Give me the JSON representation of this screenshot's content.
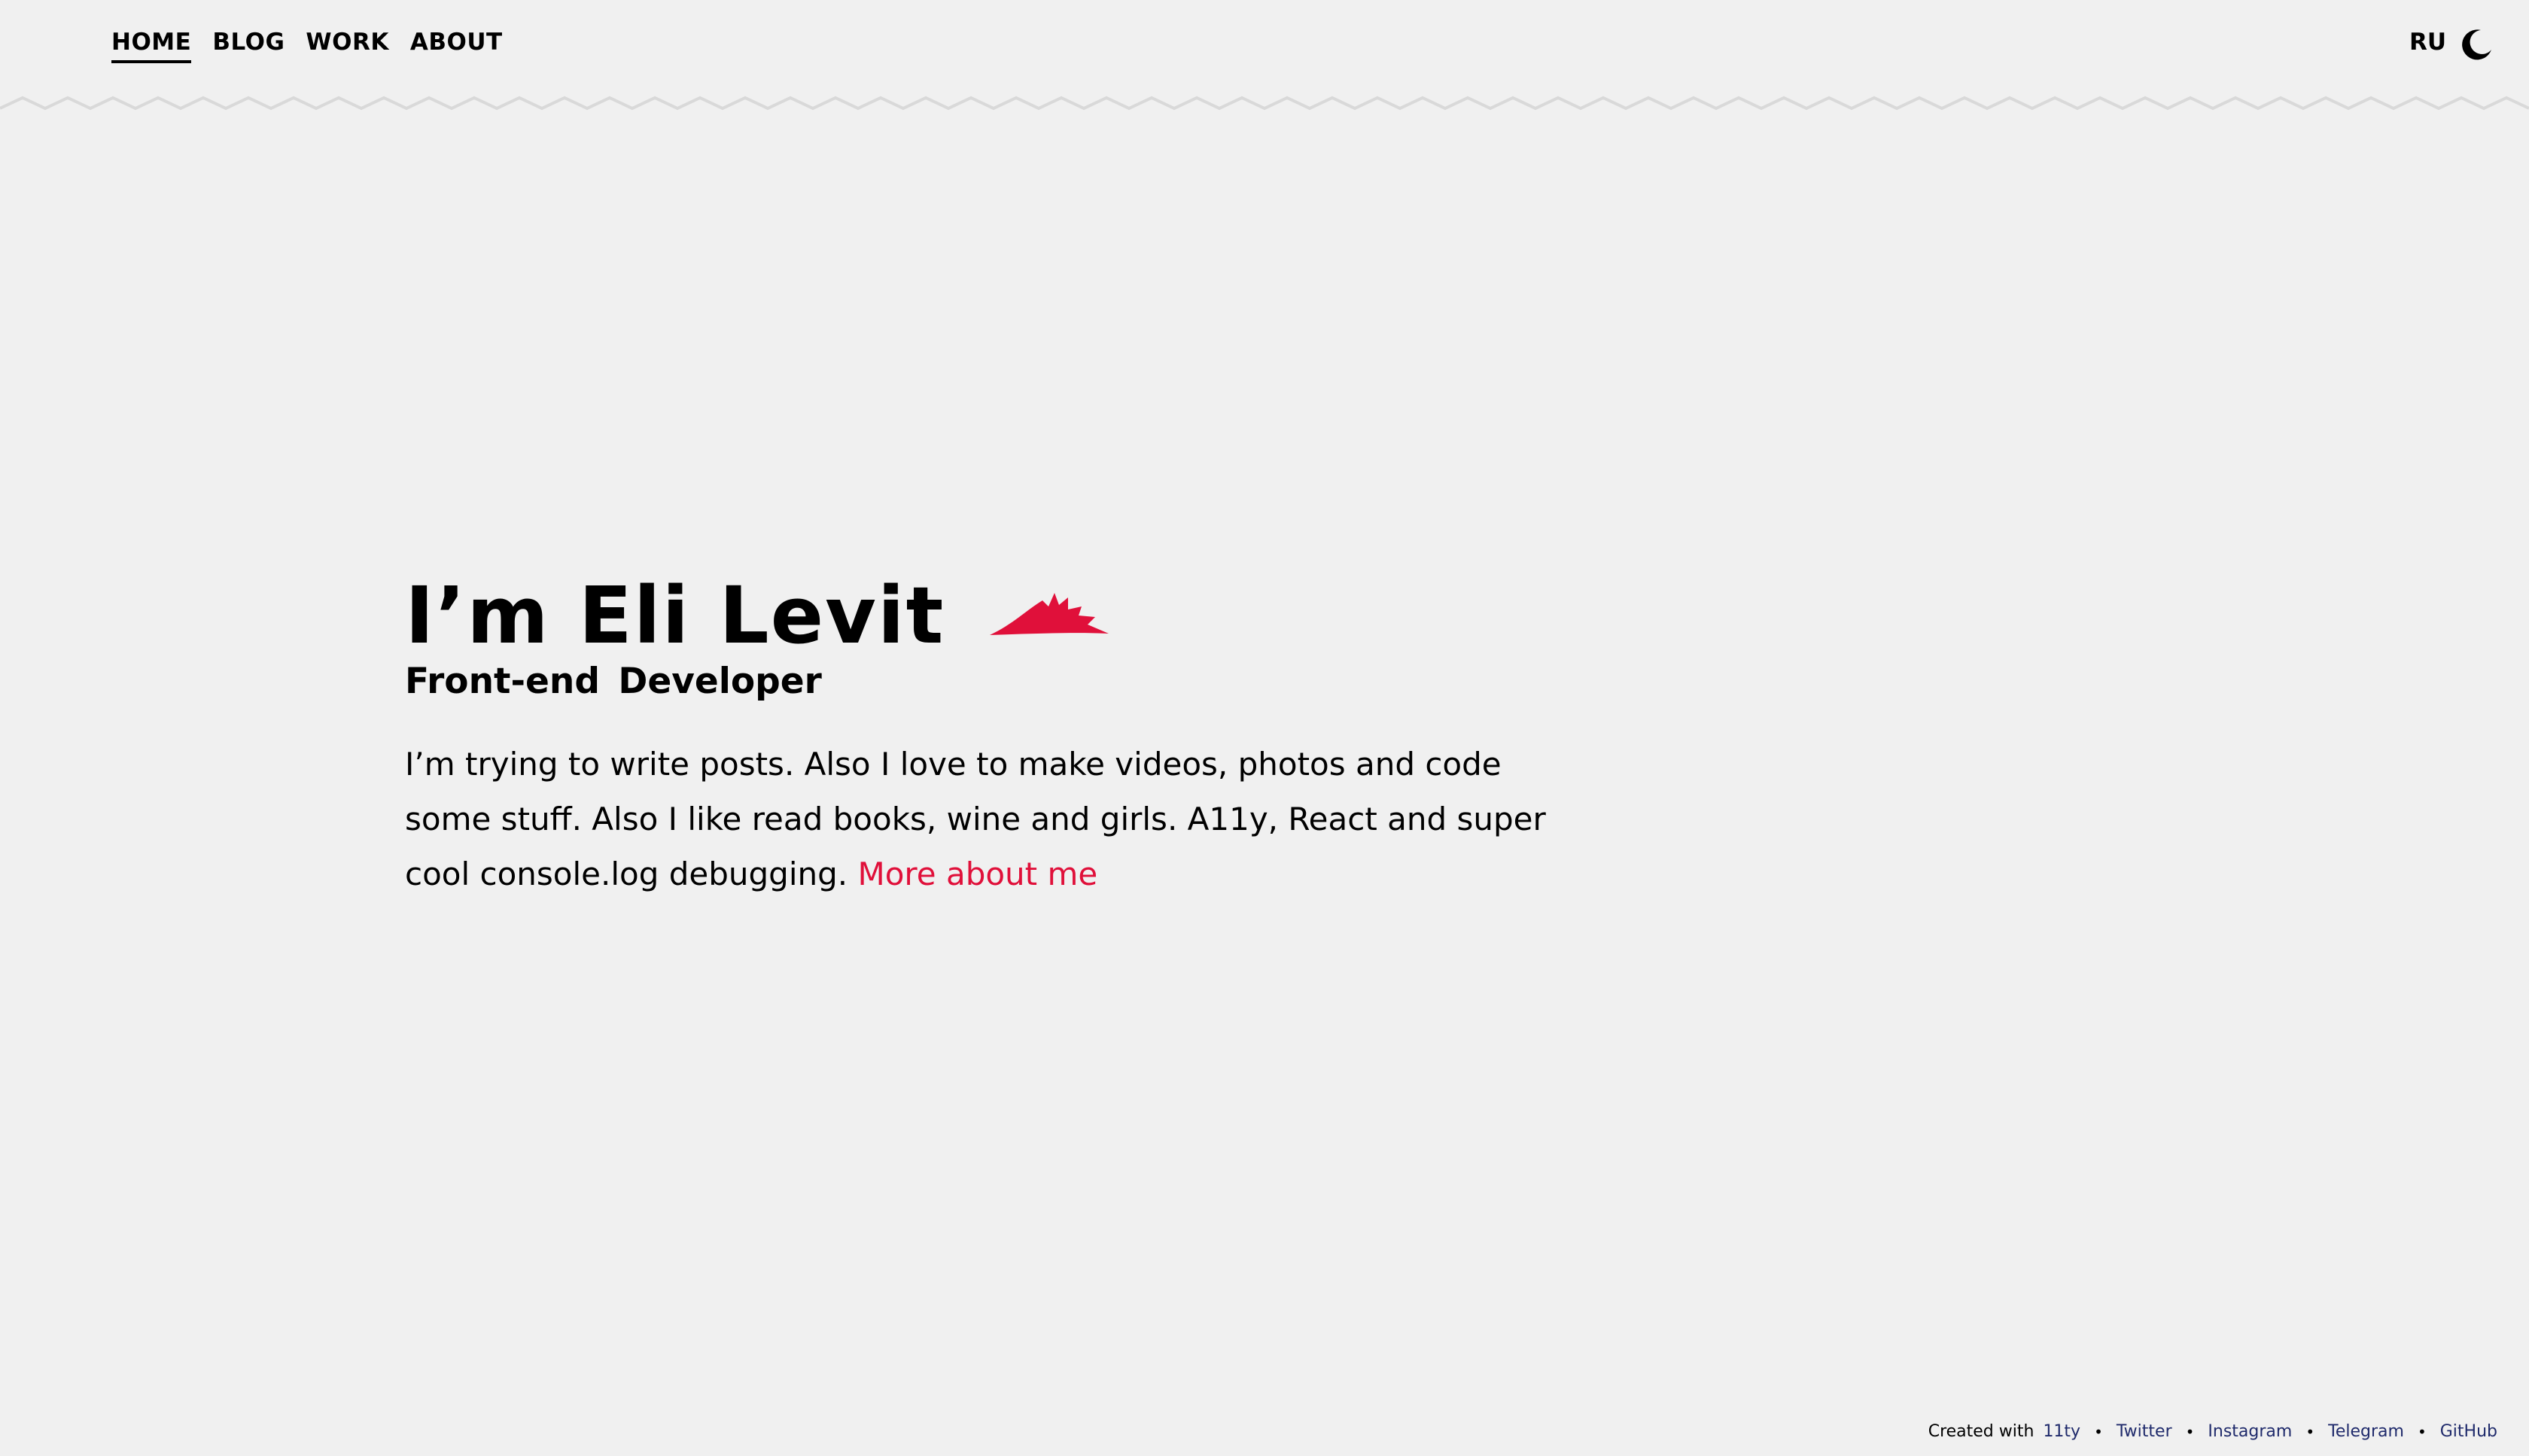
{
  "nav": {
    "items": [
      {
        "label": "HOME",
        "active": true
      },
      {
        "label": "BLOG",
        "active": false
      },
      {
        "label": "WORK",
        "active": false
      },
      {
        "label": "ABOUT",
        "active": false
      }
    ],
    "language": "RU",
    "theme_icon": "moon-icon"
  },
  "hero": {
    "title": "I’m Eli Levit",
    "subtitle": "Front-end Developer",
    "intro_text": "I’m trying to write posts. Also I love to make videos, photos and code some stuff. Also I like read books, wine and girls. A11y, React and super cool console.log debugging.",
    "more_link": "More about me",
    "splash_icon": "splash-icon",
    "accent_color": "#e0103a"
  },
  "footer": {
    "created_with": "Created with",
    "links": [
      "11ty",
      "Twitter",
      "Instagram",
      "Telegram",
      "GitHub"
    ],
    "separator": "•"
  },
  "colors": {
    "background": "#f0f0f0",
    "text": "#000000",
    "accent": "#e0103a",
    "footer_link": "#1f2a6b",
    "zigzag": "#d9d9d9"
  }
}
